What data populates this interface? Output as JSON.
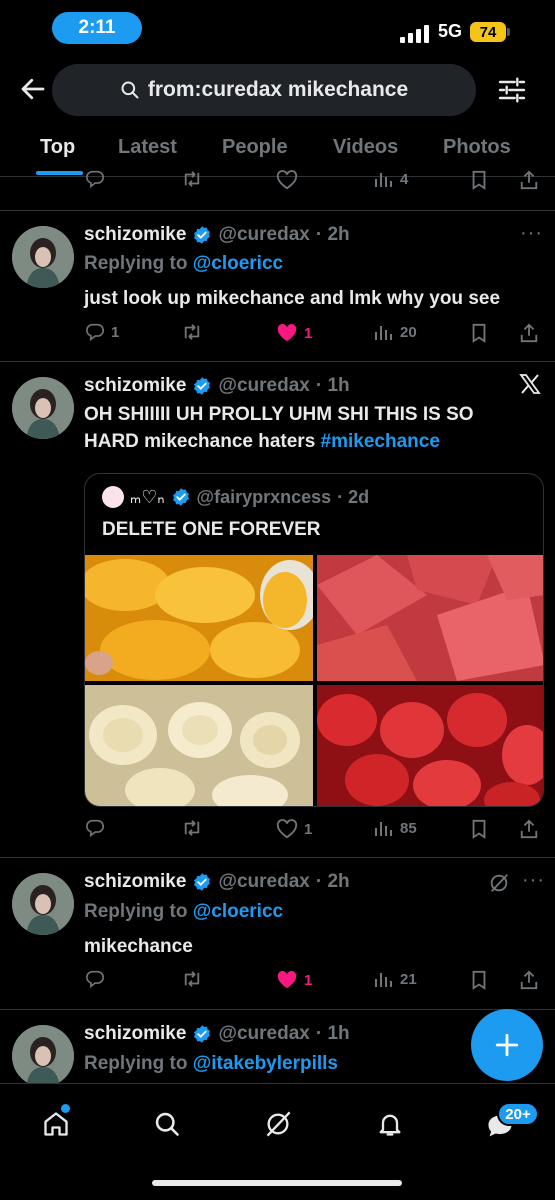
{
  "status": {
    "time": "2:11",
    "network": "5G",
    "battery": "74"
  },
  "search": {
    "query": "from:curedax mikechance"
  },
  "tabs": [
    {
      "label": "Top",
      "active": true
    },
    {
      "label": "Latest"
    },
    {
      "label": "People"
    },
    {
      "label": "Videos"
    },
    {
      "label": "Photos"
    }
  ],
  "prev_tweet": {
    "views": "4"
  },
  "tweets": [
    {
      "name": "schizomike",
      "handle": "@curedax",
      "time": "· 2h",
      "reply_prefix": "Replying to",
      "reply_to": "@cloericc",
      "text": "just look up mikechance and lmk why you see",
      "replies": "1",
      "retweets": "",
      "likes": "1",
      "views": "20"
    },
    {
      "name": "schizomike",
      "handle": "@curedax",
      "time": "· 1h",
      "text_line1": "OH SHIIIII UH PROLLY UHM SHI THIS IS SO",
      "text_line2": "HARD mikechance haters",
      "hashtag": "#mikechance",
      "quote": {
        "display_name": "ₘ♡ₙ",
        "handle": "@fairyprxncess",
        "time": "· 2d",
        "text": "DELETE ONE FOREVER"
      },
      "replies": "",
      "retweets": "",
      "likes": "1",
      "views": "85"
    },
    {
      "name": "schizomike",
      "handle": "@curedax",
      "time": "· 2h",
      "reply_prefix": "Replying to",
      "reply_to": "@cloericc",
      "text": "mikechance",
      "replies": "",
      "retweets": "",
      "likes": "1",
      "views": "21"
    },
    {
      "name": "schizomike",
      "handle": "@curedax",
      "time": "· 1h",
      "reply_prefix": "Replying to",
      "reply_to": "@itakebylerpills"
    }
  ],
  "nav": {
    "messages_badge": "20+"
  },
  "colors": {
    "accent": "#1d9bf0",
    "like": "#f91880",
    "muted": "#71767b",
    "background": "#000000"
  }
}
